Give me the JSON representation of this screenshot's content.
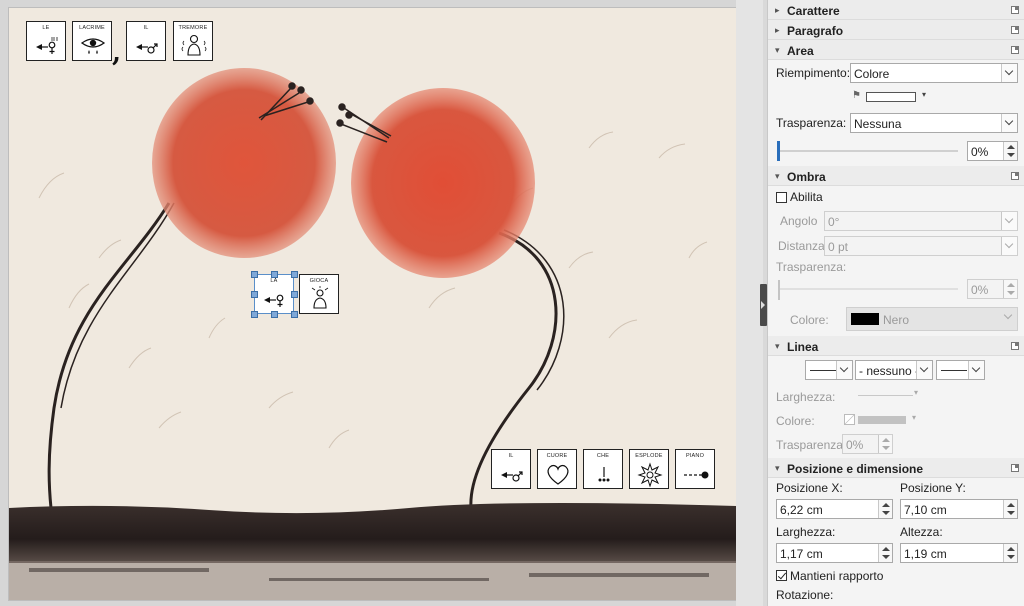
{
  "slide": {
    "top_sentence": [
      {
        "word": "LE",
        "glyph": "feminine-article-symbol"
      },
      {
        "word": "LACRIME",
        "glyph": "eye-tear-symbol"
      },
      {
        "word": "IL",
        "glyph": "masculine-article-symbol"
      },
      {
        "word": "TREMORE",
        "glyph": "trembling-person-symbol"
      }
    ],
    "comma": ",",
    "middle_sentence": [
      {
        "word": "LA",
        "glyph": "feminine-article-symbol"
      },
      {
        "word": "GIOCA",
        "glyph": "playing-person-symbol"
      }
    ],
    "bottom_sentence": [
      {
        "word": "IL",
        "glyph": "masculine-article-symbol"
      },
      {
        "word": "CUORE",
        "glyph": "heart-symbol"
      },
      {
        "word": "CHE",
        "glyph": "che-symbol"
      },
      {
        "word": "ESPLODE",
        "glyph": "explosion-symbol"
      },
      {
        "word": "PIANO",
        "glyph": "slow-dot-symbol"
      }
    ],
    "background": "painting of two red trees",
    "colors": {
      "tree_red": "#d8553f",
      "ground": "#2b2221",
      "paper": "#f0e9df"
    }
  },
  "sidebar": {
    "sections": {
      "carattere": "Carattere",
      "paragrafo": "Paragrafo",
      "area": "Area",
      "ombra": "Ombra",
      "linea": "Linea",
      "posizione": "Posizione e dimensione"
    },
    "area": {
      "riempimento_label": "Riempimento:",
      "riempimento_value": "Colore",
      "trasparenza_label": "Trasparenza:",
      "trasparenza_value": "Nessuna",
      "trasparenza_percent": "0%",
      "fill_color": "#ffffff"
    },
    "ombra": {
      "abilita_label": "Abilita",
      "angolo_label": "Angolo",
      "angolo_value": "0°",
      "distanza_label": "Distanza",
      "distanza_value": "0 pt",
      "trasparenza_label": "Trasparenza:",
      "trasparenza_value": "0%",
      "colore_label": "Colore:",
      "colore_value": "Nero",
      "colore_swatch": "#000000"
    },
    "linea": {
      "style_value": "- nessuno -",
      "larghezza_label": "Larghezza:",
      "colore_label": "Colore:",
      "trasparenza_label": "Trasparenza:",
      "trasparenza_value": "0%"
    },
    "posizione": {
      "posizione_x_label": "Posizione X:",
      "posizione_x_value": "6,22 cm",
      "posizione_y_label": "Posizione Y:",
      "posizione_y_value": "7,10 cm",
      "larghezza_label": "Larghezza:",
      "larghezza_value": "1,17 cm",
      "altezza_label": "Altezza:",
      "altezza_value": "1,19 cm",
      "mantieni_label": "Mantieni rapporto",
      "rotazione_label": "Rotazione:"
    }
  }
}
